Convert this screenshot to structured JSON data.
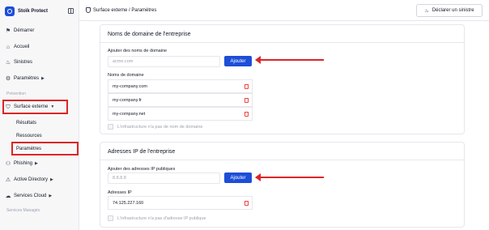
{
  "brand": {
    "name": "Stoïk Protect",
    "logo_icon": "shield-logo-icon"
  },
  "sidebar": {
    "items": [
      {
        "label": "Démarrer",
        "icon": "flag-icon"
      },
      {
        "label": "Accueil",
        "icon": "home-icon"
      },
      {
        "label": "Sinistres",
        "icon": "fire-icon"
      },
      {
        "label": "Paramètres",
        "icon": "gear-icon"
      }
    ],
    "section_prevention": "Prévention",
    "surface": {
      "label": "Surface externe"
    },
    "sub_items": [
      "Résultats",
      "Ressources",
      "Paramètres"
    ],
    "items2": [
      {
        "label": "Phishing"
      },
      {
        "label": "Active Directory"
      },
      {
        "label": "Services Cloud"
      }
    ],
    "section_managed": "Services Managés"
  },
  "header": {
    "breadcrumb": "Surface externe / Paramètres",
    "declare_label": "Déclarer un sinistre"
  },
  "domains_card": {
    "title": "Noms de domaine de l'entreprise",
    "add_label": "Ajouter des noms de domaine",
    "placeholder": "acme.com",
    "add_button": "Ajouter",
    "list_label": "Noms de domaine",
    "domains": [
      "my-company.com",
      "my-company.fr",
      "my-company.net"
    ],
    "no_domain_checkbox": "L'infrastructure n'a pas de nom de domaine"
  },
  "ip_card": {
    "title": "Adresses IP de l'entreprise",
    "add_label": "Ajouter des adresses IP publiques",
    "placeholder": "8.8.8.8",
    "add_button": "Ajouter",
    "list_label": "Adresses IP",
    "ips": [
      "74.125.227.160"
    ],
    "no_ip_checkbox": "L'infrastructure n'a pas d'adresse IP publique"
  },
  "colors": {
    "accent": "#1d4ed8",
    "highlight": "#dc2626",
    "delete": "#ef4444"
  }
}
